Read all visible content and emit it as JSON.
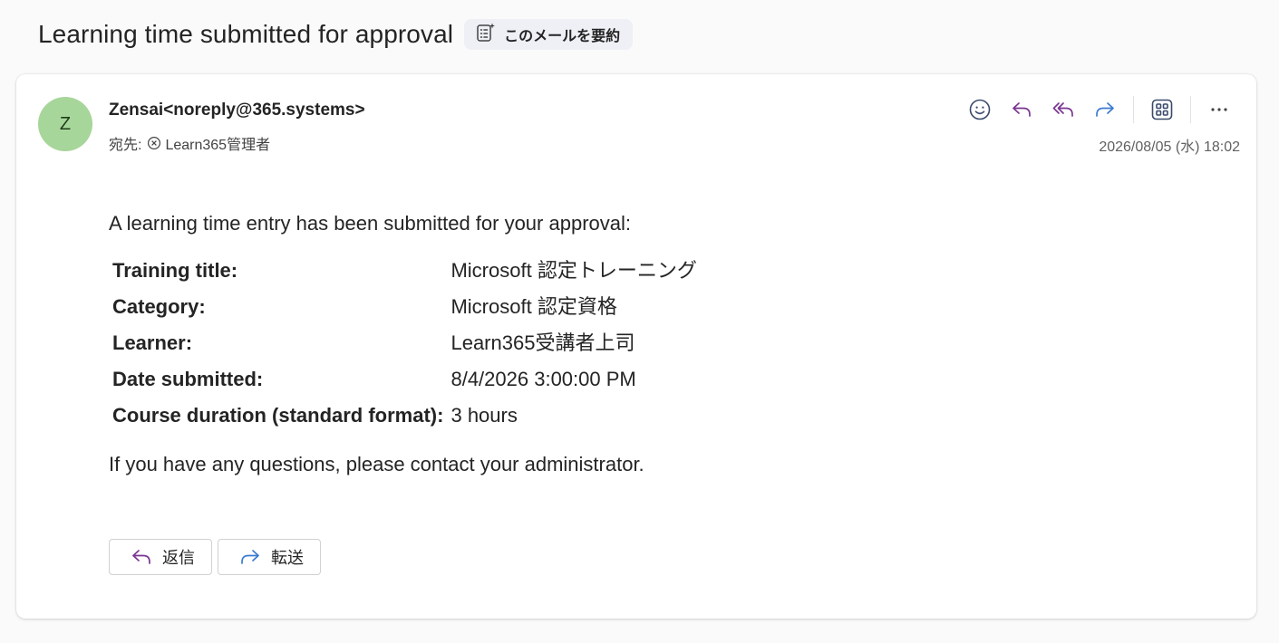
{
  "email": {
    "subject": "Learning time submitted for approval",
    "summary_label": "このメールを要約",
    "sender": "Zensai<noreply@365.systems>",
    "avatar_initial": "Z",
    "to_label": "宛先:",
    "recipient": "Learn365管理者",
    "date": "2026/08/05 (水) 18:02",
    "intro": "A learning time entry has been submitted for your approval:",
    "details": [
      {
        "label": "Training title:",
        "value": "Microsoft 認定トレーニング"
      },
      {
        "label": "Category:",
        "value": "Microsoft 認定資格"
      },
      {
        "label": "Learner:",
        "value": "Learn365受講者上司"
      },
      {
        "label": "Date submitted:",
        "value": "8/4/2026 3:00:00 PM"
      },
      {
        "label": "Course duration (standard format):",
        "value": "3 hours"
      }
    ],
    "outro": "If you have any questions, please contact your administrator."
  },
  "buttons": {
    "reply": "返信",
    "forward": "転送"
  },
  "colors": {
    "avatar_bg": "#a7d69b",
    "reply_purple": "#7a3592",
    "forward_blue": "#3b7bd0"
  },
  "icons": [
    "sparkle-summary-icon",
    "close-circle-icon",
    "emoji-icon",
    "reply-icon",
    "reply-all-icon",
    "forward-icon",
    "apps-icon",
    "more-icon"
  ]
}
